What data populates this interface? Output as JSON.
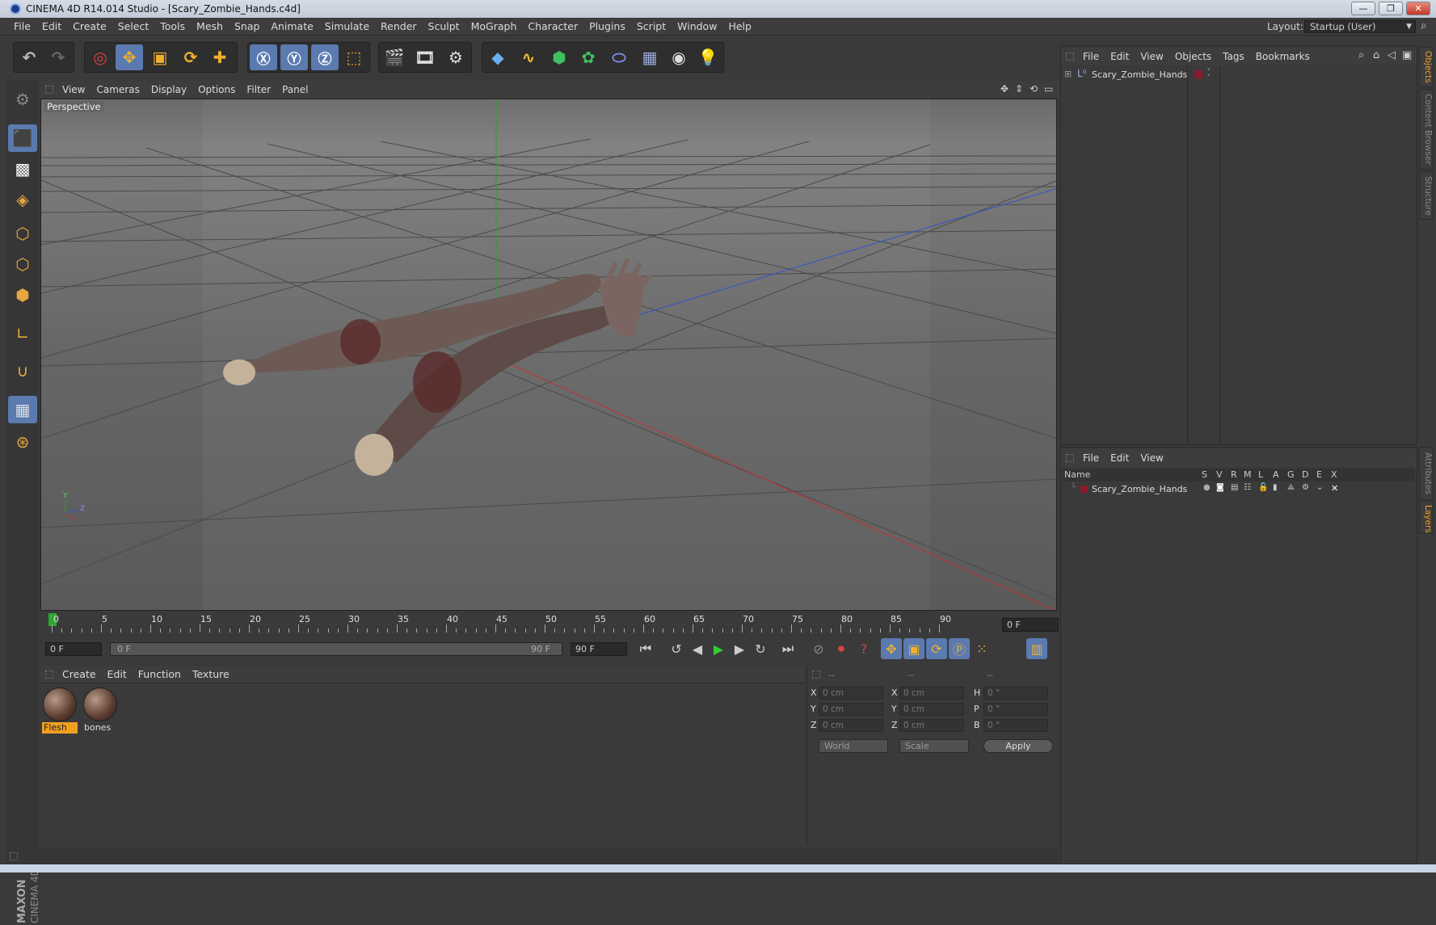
{
  "window": {
    "title": "CINEMA 4D R14.014 Studio - [Scary_Zombie_Hands.c4d]",
    "controls": [
      "—",
      "❐",
      "✕"
    ]
  },
  "menubar": {
    "items": [
      "File",
      "Edit",
      "Create",
      "Select",
      "Tools",
      "Mesh",
      "Snap",
      "Animate",
      "Simulate",
      "Render",
      "Sculpt",
      "MoGraph",
      "Character",
      "Plugins",
      "Script",
      "Window",
      "Help"
    ],
    "layout_label": "Layout:",
    "layout_value": "Startup (User)"
  },
  "viewport": {
    "menu": [
      "View",
      "Cameras",
      "Display",
      "Options",
      "Filter",
      "Panel"
    ],
    "label": "Perspective",
    "axis_y": "Y",
    "axis_z": "Z"
  },
  "timeline": {
    "ticks": [
      "0",
      "5",
      "10",
      "15",
      "20",
      "25",
      "30",
      "35",
      "40",
      "45",
      "50",
      "55",
      "60",
      "65",
      "70",
      "75",
      "80",
      "85",
      "90"
    ],
    "current_frame": "0 F",
    "start_field": "0 F",
    "range_start": "0 F",
    "range_end": "90 F",
    "end_field": "90 F"
  },
  "materials": {
    "menu": [
      "Create",
      "Edit",
      "Function",
      "Texture"
    ],
    "items": [
      {
        "name": "Flesh",
        "selected": true
      },
      {
        "name": "bones",
        "selected": false
      }
    ]
  },
  "coordinates": {
    "headers": [
      "--",
      "--",
      "--"
    ],
    "rows": [
      {
        "l1": "X",
        "v1": "0 cm",
        "l2": "X",
        "v2": "0 cm",
        "l3": "H",
        "v3": "0 °"
      },
      {
        "l1": "Y",
        "v1": "0 cm",
        "l2": "Y",
        "v2": "0 cm",
        "l3": "P",
        "v3": "0 °"
      },
      {
        "l1": "Z",
        "v1": "0 cm",
        "l2": "Z",
        "v2": "0 cm",
        "l3": "B",
        "v3": "0 °"
      }
    ],
    "mode": "World",
    "transform": "Scale",
    "apply_label": "Apply"
  },
  "objects_panel": {
    "menu": [
      "File",
      "Edit",
      "View",
      "Objects",
      "Tags",
      "Bookmarks"
    ],
    "object_name": "Scary_Zombie_Hands"
  },
  "layers_panel": {
    "menu": [
      "File",
      "Edit",
      "View"
    ],
    "columns": [
      "Name",
      "S",
      "V",
      "R",
      "M",
      "L",
      "A",
      "G",
      "D",
      "E",
      "X"
    ],
    "layer_name": "Scary_Zombie_Hands",
    "layer_color": "#8a1a2a"
  },
  "side_tabs": [
    "Objects",
    "Content Browser",
    "Structure",
    "Attributes",
    "Layers"
  ],
  "branding": {
    "line1": "MAXON",
    "line2": "CINEMA 4D"
  },
  "colors": {
    "accent": "#5a7ab0",
    "selection": "#f0a020",
    "y_axis": "#2aa02a",
    "x_axis": "#c83030",
    "z_axis": "#3050d0"
  }
}
